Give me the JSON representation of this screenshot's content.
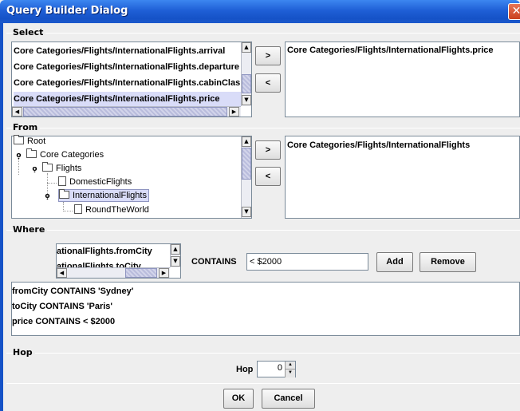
{
  "window": {
    "title": "Query Builder Dialog",
    "close_glyph": "✕"
  },
  "select": {
    "label": "Select",
    "available": [
      "Core Categories/Flights/InternationalFlights.arrival",
      "Core Categories/Flights/InternationalFlights.departure",
      "Core Categories/Flights/InternationalFlights.cabinClas",
      "Core Categories/Flights/InternationalFlights.price"
    ],
    "selected_index": 3,
    "add_label": ">",
    "remove_label": "<",
    "chosen": [
      "Core Categories/Flights/InternationalFlights.price"
    ]
  },
  "from": {
    "label": "From",
    "tree": [
      {
        "label": "Root",
        "depth": 0,
        "icon": "folder",
        "expander": ""
      },
      {
        "label": "Core Categories",
        "depth": 1,
        "icon": "folder",
        "expander": "o-"
      },
      {
        "label": "Flights",
        "depth": 2,
        "icon": "folder",
        "expander": "o-"
      },
      {
        "label": "DomesticFlights",
        "depth": 3,
        "icon": "document",
        "expander": ""
      },
      {
        "label": "InternationalFlights",
        "depth": 3,
        "icon": "folder",
        "expander": "o-",
        "selected": true
      },
      {
        "label": "RoundTheWorld",
        "depth": 4,
        "icon": "document",
        "expander": ""
      }
    ],
    "add_label": ">",
    "remove_label": "<",
    "chosen": [
      "Core Categories/Flights/InternationalFlights"
    ]
  },
  "where": {
    "label": "Where",
    "fields": [
      "ationalFlights.fromCity",
      "ationalFlights.toCity"
    ],
    "operator": "CONTAINS",
    "value": "< $2000",
    "add_label": "Add",
    "remove_label": "Remove",
    "conditions": [
      "fromCity CONTAINS 'Sydney'",
      "toCity CONTAINS 'Paris'",
      "price CONTAINS < $2000"
    ]
  },
  "hop": {
    "label": "Hop",
    "field_label": "Hop",
    "value": "0"
  },
  "footer": {
    "ok_label": "OK",
    "cancel_label": "Cancel"
  },
  "colors": {
    "title_bar": "#1f5fd6",
    "selection": "#d9dcf8",
    "background": "#eeeeee"
  }
}
